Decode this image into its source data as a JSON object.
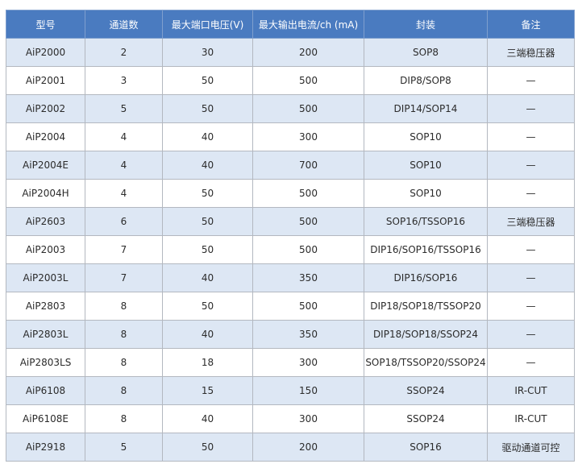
{
  "table": {
    "headers": [
      "型号",
      "通道数",
      "最大端口电压(V)",
      "最大输出电流/ch (mA)",
      "封装",
      "备注"
    ],
    "rows": [
      [
        "AiP2000",
        "2",
        "30",
        "200",
        "SOP8",
        "三端稳压器"
      ],
      [
        "AiP2001",
        "3",
        "50",
        "500",
        "DIP8/SOP8",
        "—"
      ],
      [
        "AiP2002",
        "5",
        "50",
        "500",
        "DIP14/SOP14",
        "—"
      ],
      [
        "AiP2004",
        "4",
        "40",
        "300",
        "SOP10",
        "—"
      ],
      [
        "AiP2004E",
        "4",
        "40",
        "700",
        "SOP10",
        "—"
      ],
      [
        "AiP2004H",
        "4",
        "50",
        "500",
        "SOP10",
        "—"
      ],
      [
        "AiP2603",
        "6",
        "50",
        "500",
        "SOP16/TSSOP16",
        "三端稳压器"
      ],
      [
        "AiP2003",
        "7",
        "50",
        "500",
        "DIP16/SOP16/TSSOP16",
        "—"
      ],
      [
        "AiP2003L",
        "7",
        "40",
        "350",
        "DIP16/SOP16",
        "—"
      ],
      [
        "AiP2803",
        "8",
        "50",
        "500",
        "DIP18/SOP18/TSSOP20",
        "—"
      ],
      [
        "AiP2803L",
        "8",
        "40",
        "350",
        "DIP18/SOP18/SSOP24",
        "—"
      ],
      [
        "AiP2803LS",
        "8",
        "18",
        "300",
        "SOP18/TSSOP20/SSOP24",
        "—"
      ],
      [
        "AiP6108",
        "8",
        "15",
        "150",
        "SSOP24",
        "IR-CUT"
      ],
      [
        "AiP6108E",
        "8",
        "40",
        "300",
        "SSOP24",
        "IR-CUT"
      ],
      [
        "AiP2918",
        "5",
        "50",
        "200",
        "SOP16",
        "驱动通道可控"
      ]
    ]
  },
  "colors": {
    "header_bg": "#4a7bc0",
    "header_text": "#ffffff",
    "row_shaded": "#dde7f4",
    "row_plain": "#ffffff",
    "border": "#b3b8c0"
  }
}
